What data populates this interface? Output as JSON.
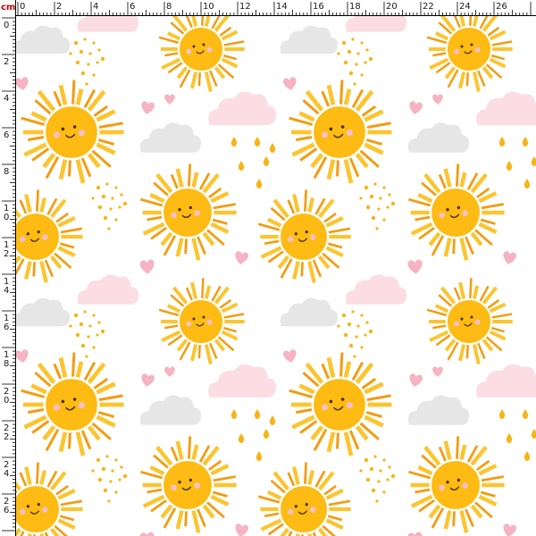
{
  "ruler": {
    "unit_label": "cm",
    "top_labels": [
      "0",
      "2",
      "4",
      "6",
      "8",
      "10",
      "12",
      "14",
      "16",
      "18",
      "20",
      "22",
      "24",
      "26"
    ],
    "left_labels": [
      "0",
      "2",
      "4",
      "6",
      "8",
      "10",
      "12",
      "14",
      "16",
      "18",
      "20",
      "22",
      "24",
      "26"
    ],
    "background": "#ffffff",
    "tick_color": "#000000",
    "label_color": "#1a1a1a",
    "unit_color": "#cc0000"
  },
  "pattern": {
    "description_icons": [
      "sun-icon",
      "cloud-icon",
      "heart-icon",
      "raindrop-icon",
      "dot-icon"
    ],
    "colors": {
      "sun_core": "#fdbb13",
      "sun_core_edge": "#ffffff",
      "sun_ray_light": "#fbc531",
      "sun_ray_dark": "#f39c12",
      "cheek": "#f8c0c8",
      "face": "#4a3000",
      "cloud_grey": "#e6e6e6",
      "cloud_pink": "#fbdde3",
      "heart": "#f5b3c4",
      "drop": "#f7b416",
      "dot": "#f7b416"
    }
  }
}
